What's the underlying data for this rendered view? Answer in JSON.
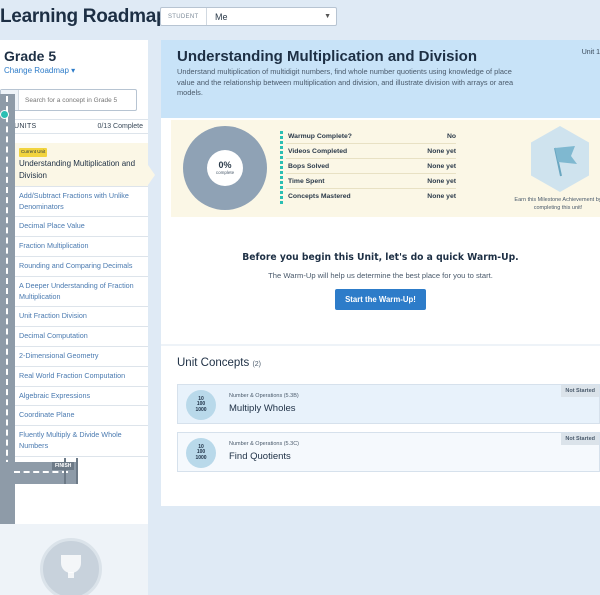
{
  "app": {
    "title": "Learning Roadmap"
  },
  "student": {
    "label": "STUDENT",
    "value": "Me"
  },
  "sidebar": {
    "grade": "Grade 5",
    "change_roadmap": "Change Roadmap ▾",
    "search_placeholder": "Search for a concept in Grade 5",
    "units_label": "UNITS",
    "units_count": "0/13 Complete",
    "current_badge": "Current Unit",
    "finish_label": "FINISH",
    "units": [
      "Understanding Multiplication and Division",
      "Add/Subtract Fractions with Unlike Denominators",
      "Decimal Place Value",
      "Fraction Multiplication",
      "Rounding and Comparing Decimals",
      "A Deeper Understanding of Fraction Multiplication",
      "Unit Fraction Division",
      "Decimal Computation",
      "2-Dimensional Geometry",
      "Real World Fraction Computation",
      "Algebraic Expressions",
      "Coordinate Plane",
      "Fluently Multiply & Divide Whole Numbers"
    ]
  },
  "unit": {
    "title": "Understanding Multiplication and Division",
    "number": "Unit 1",
    "description": "Understand multiplication of multidigit numbers, find whole number quotients using knowledge of place value and the relationship between multiplication and division, and illustrate division with arrays or area models.",
    "progress_pct": "0%",
    "progress_sub": "complete",
    "stats": [
      {
        "label": "Warmup Complete?",
        "value": "No"
      },
      {
        "label": "Videos Completed",
        "value": "None yet"
      },
      {
        "label": "Bops Solved",
        "value": "None yet"
      },
      {
        "label": "Time Spent",
        "value": "None yet"
      },
      {
        "label": "Concepts Mastered",
        "value": "None yet"
      }
    ],
    "milestone_text": "Earn this Milestone Achievement by completing this unit!"
  },
  "warmup": {
    "title": "Before you begin this Unit, let's do a quick Warm-Up.",
    "subtitle": "The Warm-Up will help us determine the best place for you to start.",
    "button": "Start the Warm-Up!"
  },
  "concepts": {
    "title": "Unit Concepts",
    "count": "(2)",
    "items": [
      {
        "category": "Number & Operations (5.3B)",
        "name": "Multiply Wholes",
        "status": "Not Started",
        "icon": [
          "10",
          "100",
          "1000"
        ]
      },
      {
        "category": "Number & Operations (5.3C)",
        "name": "Find Quotients",
        "status": "Not Started",
        "icon": [
          "10",
          "100",
          "1000"
        ]
      }
    ]
  },
  "colors": {
    "accent": "#2d7cc9",
    "header_bg": "#c8e3f8",
    "highlight": "#fbf7e6",
    "teal": "#2bbfb3"
  }
}
